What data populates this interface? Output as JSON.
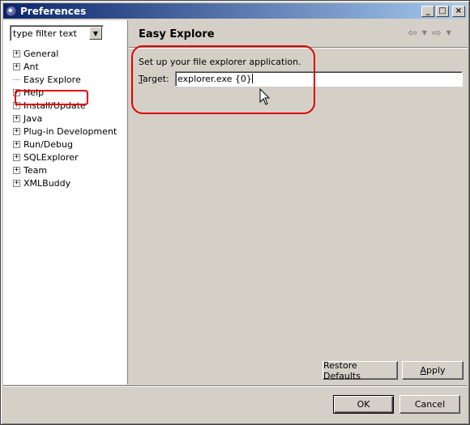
{
  "window": {
    "title": "Preferences"
  },
  "titlebar_buttons": {
    "minimize": "_",
    "maximize": "□",
    "close": "×"
  },
  "filter": {
    "value": "type filter text"
  },
  "tree": {
    "items": [
      {
        "label": "General",
        "expandable": true
      },
      {
        "label": "Ant",
        "expandable": true
      },
      {
        "label": "Easy Explore",
        "expandable": false
      },
      {
        "label": "Help",
        "expandable": true
      },
      {
        "label": "Install/Update",
        "expandable": true
      },
      {
        "label": "Java",
        "expandable": true
      },
      {
        "label": "Plug-in Development",
        "expandable": true
      },
      {
        "label": "Run/Debug",
        "expandable": true
      },
      {
        "label": "SQLExplorer",
        "expandable": true
      },
      {
        "label": "Team",
        "expandable": true
      },
      {
        "label": "XMLBuddy",
        "expandable": true
      }
    ]
  },
  "page": {
    "title": "Easy Explore",
    "description": "Set up your file explorer application.",
    "target_label_mnemonic": "T",
    "target_label_rest": "arget:",
    "target_value": "explorer.exe {0}"
  },
  "buttons": {
    "restore_defaults": "Restore Defaults",
    "apply_mnemonic": "A",
    "apply_rest": "pply",
    "ok": "OK",
    "cancel": "Cancel"
  },
  "colors": {
    "annotation": "#e00000",
    "titlebar_start": "#0a246a",
    "titlebar_end": "#a6caf0"
  }
}
